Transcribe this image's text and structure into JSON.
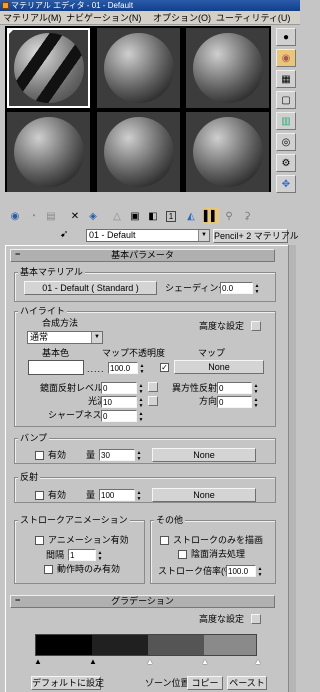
{
  "window": {
    "title": "マテリアル エディタ - 01 - Default"
  },
  "menu": {
    "items": [
      "マテリアル(M)",
      "ナビゲーション(N)",
      "オプション(O)",
      "ユーティリティ(U)"
    ]
  },
  "material": {
    "name": "01 - Default",
    "type": "Pencil+ 2 マテリアル"
  },
  "basic_params": {
    "title": "基本パラメータ",
    "base_material_group": "基本マテリアル",
    "base_material_button": "01 - Default ( Standard )",
    "shading_label": "シェーディング",
    "shading_value": "0.0"
  },
  "highlight": {
    "group": "ハイライト",
    "blend_label": "合成方法",
    "blend_value": "通常",
    "advanced_label": "高度な設定",
    "base_color_label": "基本色",
    "map_opacity_label": "マップ不透明度",
    "map_label": "マップ",
    "opacity_value": "100.0",
    "map_button": "None",
    "specular_label": "鏡面反射レベル",
    "specular_value": "0",
    "gloss_label": "光沢",
    "gloss_value": "10",
    "sharpness_label": "シャープネス",
    "sharpness_value": "0",
    "aniso_label": "異方性反射",
    "aniso_value": "0",
    "direction_label": "方向",
    "direction_value": "0"
  },
  "bump": {
    "group": "バンプ",
    "enable_label": "有効",
    "amount_label": "量",
    "amount_value": "30",
    "map_button": "None"
  },
  "reflection": {
    "group": "反射",
    "enable_label": "有効",
    "amount_label": "量",
    "amount_value": "100",
    "map_button": "None"
  },
  "stroke_anim": {
    "group": "ストロークアニメーション",
    "enable_label": "アニメーション有効",
    "interval_label": "間隔",
    "interval_value": "1",
    "motion_label": "動作時のみ有効"
  },
  "other": {
    "group": "その他",
    "stroke_only_label": "ストロークのみを描画",
    "hidden_label": "陰面消去処理",
    "stroke_rate_label": "ストローク倍率(%)",
    "stroke_rate_value": "100.0"
  },
  "gradation": {
    "title": "グラデーション",
    "advanced_label": "高度な設定",
    "default_button": "デフォルトに設定",
    "zone_label": "ゾーン位置",
    "copy_label": "コピー",
    "paste_label": "ペースト",
    "zones": [
      "#000000",
      "#202020",
      "#555555",
      "#8a8a8a",
      "#c8c8c8"
    ]
  },
  "colors": {
    "titlebar": "#1a4a98",
    "panel": "#c5c5c5",
    "slot_bg": "#3c3c3c"
  },
  "sidebar_icons": [
    "sample-type-icon",
    "backlight-icon",
    "background-icon",
    "uv-tiling-icon",
    "video-check-icon",
    "make-preview-icon",
    "options-icon",
    "select-by-material-icon"
  ],
  "toolbar_icons": [
    "get-material-icon",
    "put-to-scene-icon",
    "assign-icon",
    "reset-icon",
    "make-copy-icon",
    "make-unique-icon",
    "put-to-library-icon",
    "material-id-icon",
    "show-map-icon",
    "show-end-result-icon",
    "go-parent-icon",
    "go-sibling-icon"
  ]
}
